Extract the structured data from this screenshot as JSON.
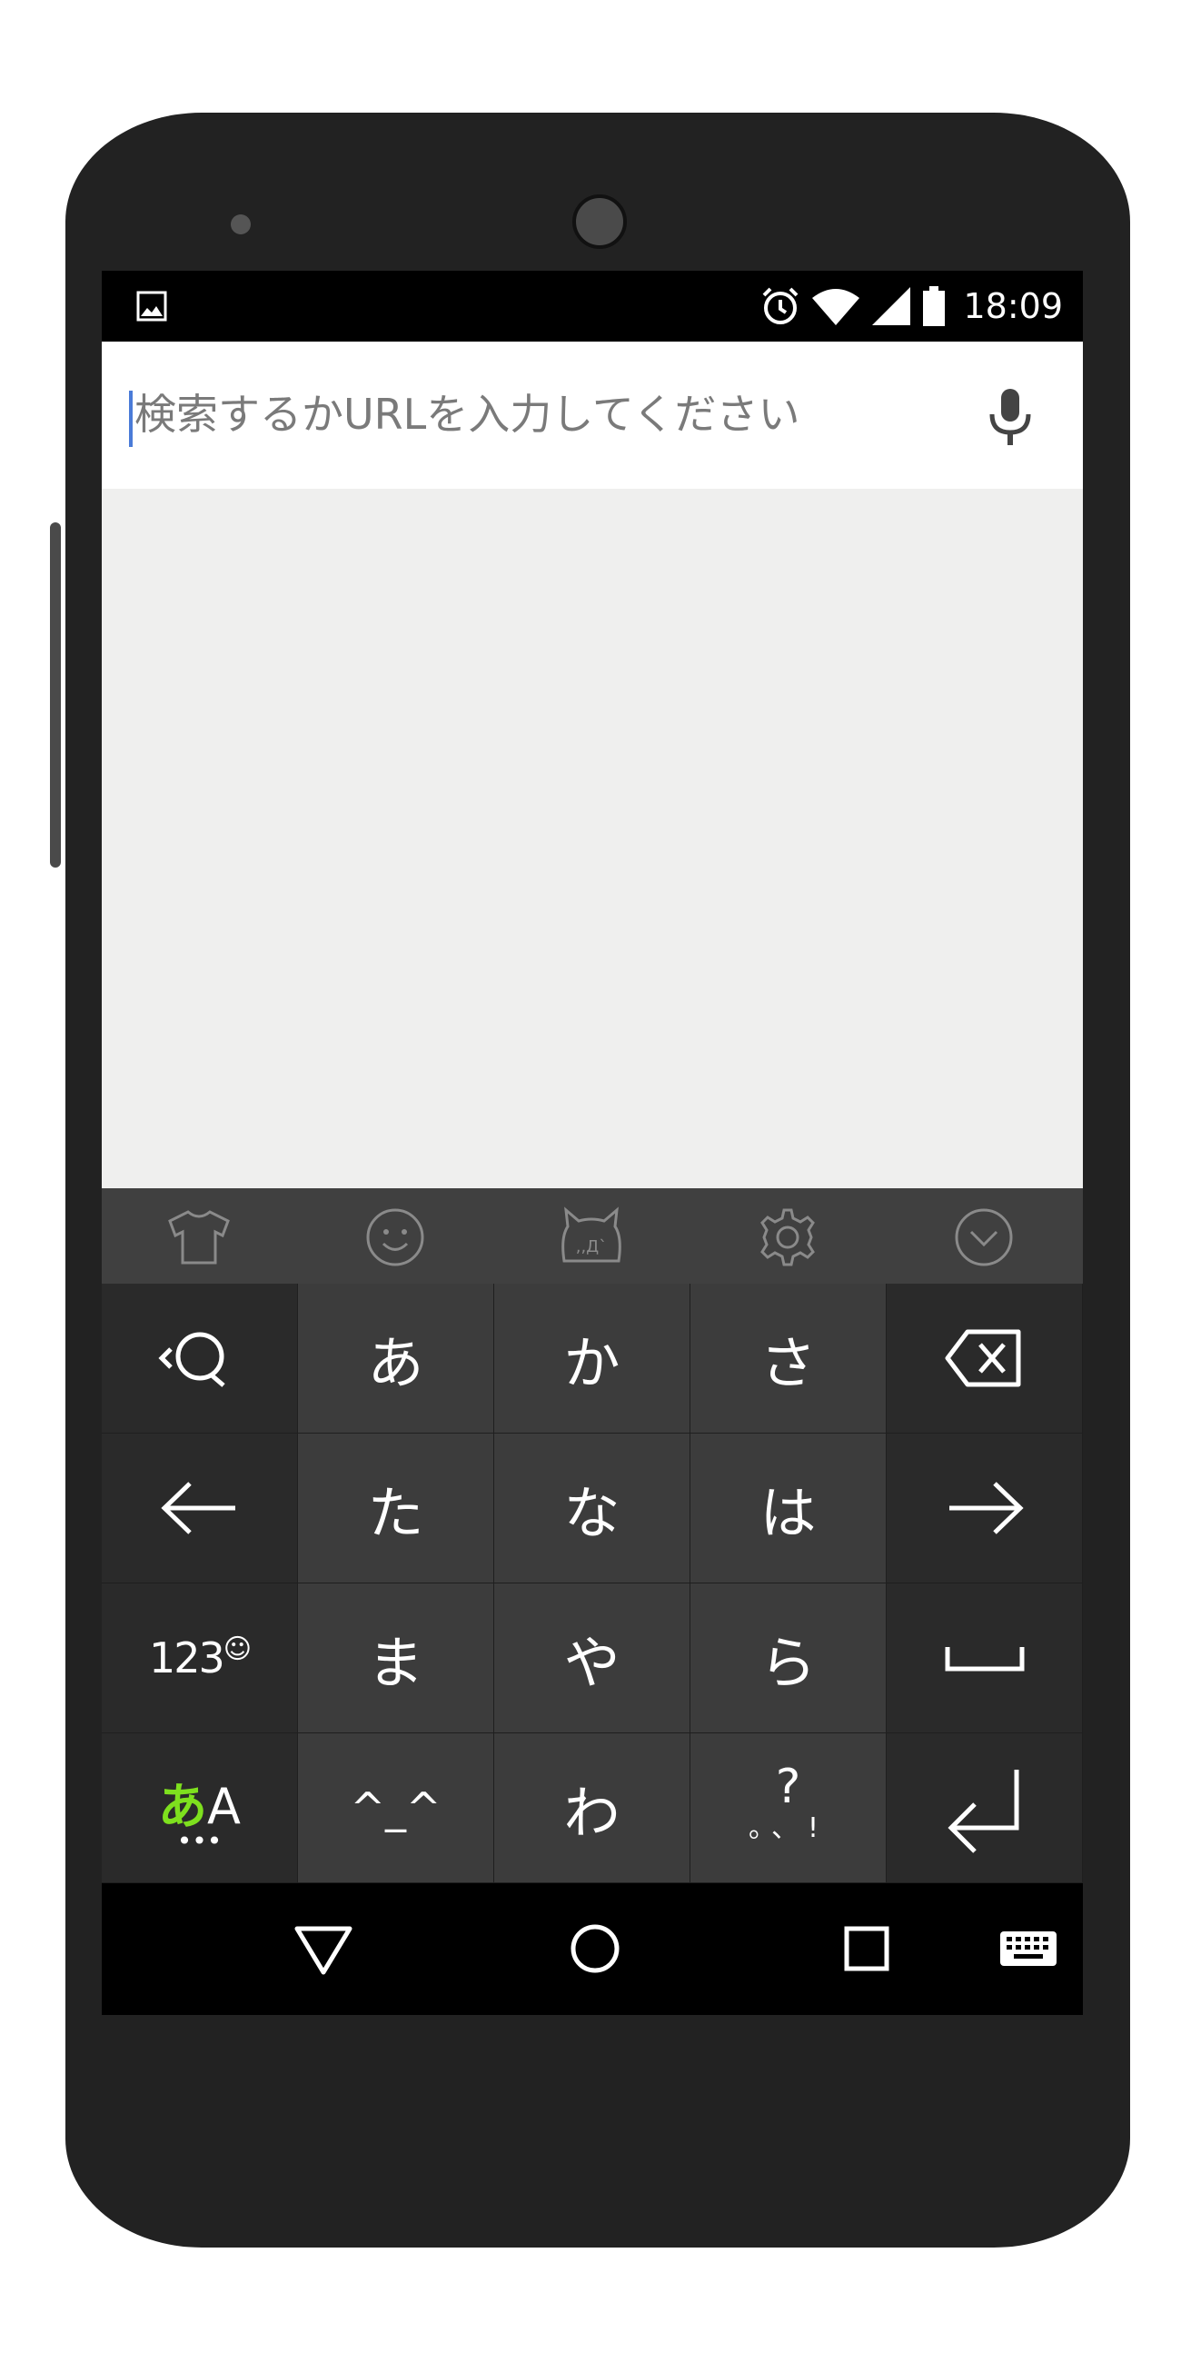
{
  "status_bar": {
    "time": "18:09",
    "icons": [
      "image-notification-icon",
      "alarm-icon",
      "wifi-icon",
      "signal-icon",
      "battery-icon"
    ]
  },
  "search": {
    "placeholder": "検索するかURLを入力してください",
    "value": ""
  },
  "keyboard_toolbar": {
    "items": [
      "theme-shirt-icon",
      "emoji-icon",
      "kaomoji-icon",
      "settings-gear-icon",
      "collapse-keyboard-icon"
    ]
  },
  "keyboard": {
    "rows": [
      [
        "search-key",
        "あ",
        "か",
        "さ",
        "backspace"
      ],
      [
        "left-arrow",
        "た",
        "な",
        "は",
        "right-arrow"
      ],
      [
        "123☺",
        "ま",
        "や",
        "ら",
        "space"
      ],
      [
        "あA",
        "^_^",
        "わ",
        "?。、!",
        "enter"
      ]
    ],
    "labels": {
      "a": "あ",
      "ka": "か",
      "sa": "さ",
      "ta": "た",
      "na": "な",
      "ha": "は",
      "ma": "ま",
      "ya": "や",
      "ra": "ら",
      "wa": "わ",
      "num_main": "123",
      "num_smile": "☺",
      "mode_kana": "あ",
      "mode_latin": "A",
      "mode_dots": "•••",
      "kaomoji": "^_^",
      "punct_top": "?",
      "punct_bottom": "。、!"
    }
  },
  "colors": {
    "accent_green": "#7ee01e",
    "cursor_blue": "#4a7bd8"
  },
  "nav_bar": {
    "items": [
      "back-icon",
      "home-icon",
      "recents-icon",
      "keyboard-switch-icon"
    ]
  }
}
